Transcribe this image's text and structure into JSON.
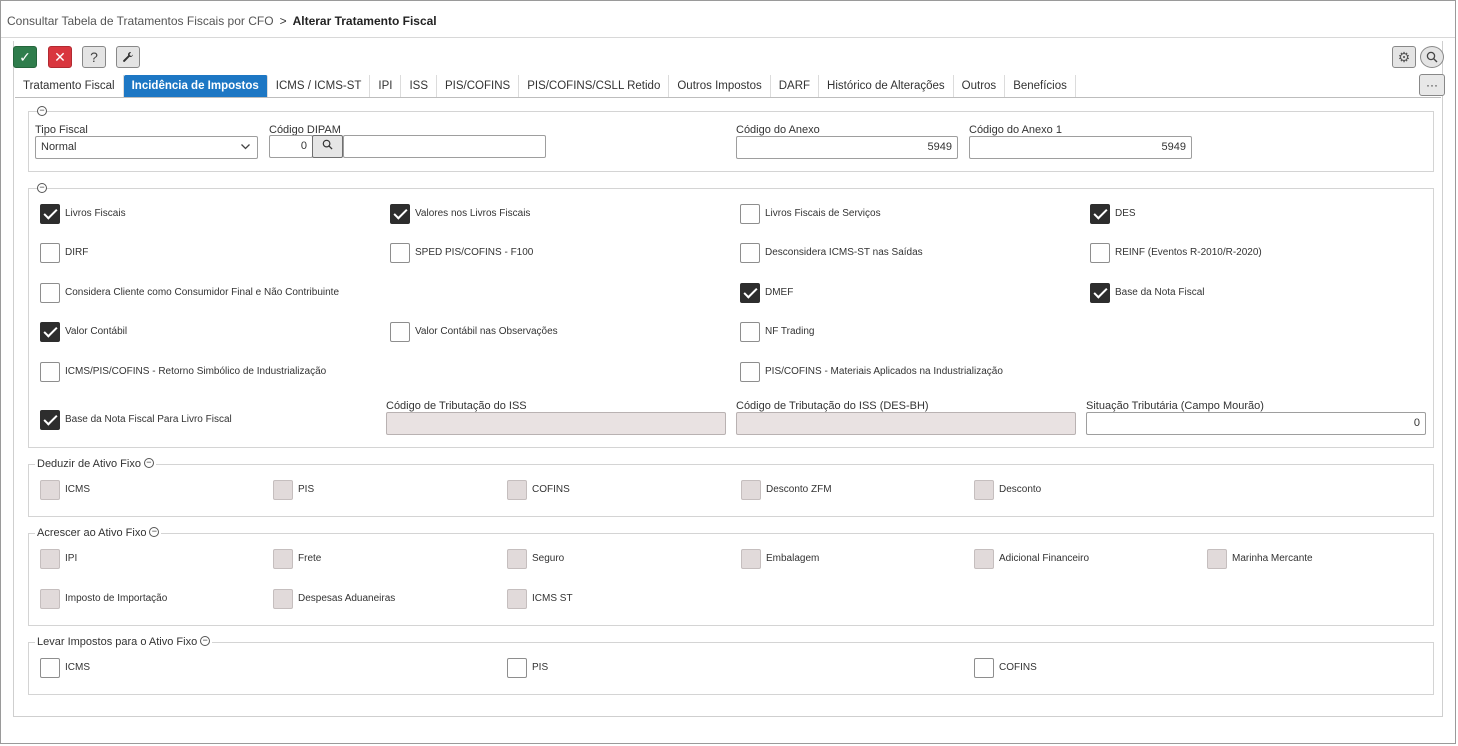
{
  "breadcrumb": {
    "parent": "Consultar Tabela de Tratamentos Fiscais por CFO",
    "separator": ">",
    "current": "Alterar Tratamento Fiscal"
  },
  "toolbar": {
    "confirm_icon": "✓",
    "cancel_icon": "✕",
    "help_icon": "?",
    "tools_icon": "🔧",
    "settings_icon": "⚙",
    "search_icon": "🔍",
    "more_icon": "···"
  },
  "tabs": [
    "Tratamento Fiscal",
    "Incidência de Impostos",
    "ICMS / ICMS-ST",
    "IPI",
    "ISS",
    "PIS/COFINS",
    "PIS/COFINS/CSLL Retido",
    "Outros Impostos",
    "DARF",
    "Histórico de Alterações",
    "Outros",
    "Benefícios"
  ],
  "active_tab": "Incidência de Impostos",
  "section1": {
    "tipo_fiscal": {
      "label": "Tipo Fiscal",
      "value": "Normal"
    },
    "codigo_dipam": {
      "label": "Código DIPAM",
      "value": "0",
      "description": ""
    },
    "codigo_anexo": {
      "label": "Código do Anexo",
      "value": "5949"
    },
    "codigo_anexo1": {
      "label": "Código do Anexo 1",
      "value": "5949"
    }
  },
  "section2": {
    "checkboxes": [
      {
        "label": "Livros Fiscais",
        "checked": true
      },
      {
        "label": "Valores nos Livros Fiscais",
        "checked": true
      },
      {
        "label": "Livros Fiscais de Serviços",
        "checked": false
      },
      {
        "label": "DES",
        "checked": true
      },
      {
        "label": "DIRF",
        "checked": false
      },
      {
        "label": "SPED PIS/COFINS - F100",
        "checked": false
      },
      {
        "label": "Desconsidera ICMS-ST nas Saídas",
        "checked": false
      },
      {
        "label": "REINF (Eventos R-2010/R-2020)",
        "checked": false
      },
      {
        "label": "Considera Cliente como Consumidor Final e Não Contribuinte",
        "checked": false
      },
      {
        "label": "DMEF",
        "checked": true
      },
      {
        "label": "Base da Nota Fiscal",
        "checked": true
      },
      {
        "label": "Valor Contábil",
        "checked": true
      },
      {
        "label": "Valor Contábil nas Observações",
        "checked": false
      },
      {
        "label": "NF Trading",
        "checked": false
      },
      {
        "label": "ICMS/PIS/COFINS - Retorno Simbólico de Industrialização",
        "checked": false
      },
      {
        "label": "PIS/COFINS - Materiais Aplicados na Industrialização",
        "checked": false
      },
      {
        "label": "Base da Nota Fiscal Para Livro Fiscal",
        "checked": true
      }
    ],
    "codigo_tributacao_iss": {
      "label": "Código de Tributação do ISS",
      "value": ""
    },
    "codigo_tributacao_iss_desbh": {
      "label": "Código de Tributação do ISS (DES-BH)",
      "value": ""
    },
    "situacao_tributaria": {
      "label": "Situação Tributária (Campo Mourão)",
      "value": "0"
    }
  },
  "deduzir": {
    "title": "Deduzir de Ativo Fixo",
    "items": [
      "ICMS",
      "PIS",
      "COFINS",
      "Desconto ZFM",
      "Desconto"
    ]
  },
  "acrescer": {
    "title": "Acrescer ao Ativo Fixo",
    "items": [
      "IPI",
      "Frete",
      "Seguro",
      "Embalagem",
      "Adicional Financeiro",
      "Marinha Mercante",
      "Imposto de Importação",
      "Despesas Aduaneiras",
      "ICMS ST"
    ]
  },
  "levar": {
    "title": "Levar Impostos para o Ativo Fixo",
    "items": [
      "ICMS",
      "PIS",
      "COFINS"
    ]
  },
  "colors": {
    "accent": "#1d77c4",
    "confirm": "#2f7d4c",
    "cancel": "#d9363e"
  }
}
